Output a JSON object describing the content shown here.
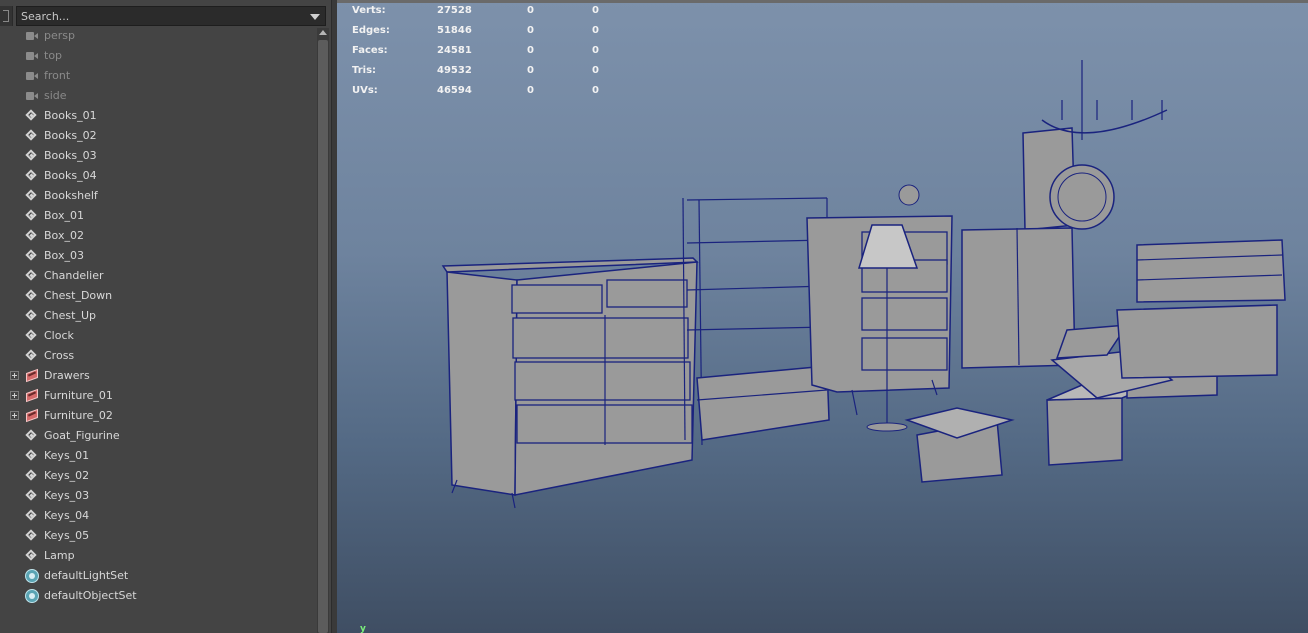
{
  "outliner": {
    "search_placeholder": "Search...",
    "items": [
      {
        "label": "persp",
        "type": "camera",
        "dim": true
      },
      {
        "label": "top",
        "type": "camera",
        "dim": true
      },
      {
        "label": "front",
        "type": "camera",
        "dim": true
      },
      {
        "label": "side",
        "type": "camera",
        "dim": true
      },
      {
        "label": "Books_01",
        "type": "mesh"
      },
      {
        "label": "Books_02",
        "type": "mesh"
      },
      {
        "label": "Books_03",
        "type": "mesh"
      },
      {
        "label": "Books_04",
        "type": "mesh"
      },
      {
        "label": "Bookshelf",
        "type": "mesh"
      },
      {
        "label": "Box_01",
        "type": "mesh"
      },
      {
        "label": "Box_02",
        "type": "mesh"
      },
      {
        "label": "Box_03",
        "type": "mesh"
      },
      {
        "label": "Chandelier",
        "type": "mesh"
      },
      {
        "label": "Chest_Down",
        "type": "mesh"
      },
      {
        "label": "Chest_Up",
        "type": "mesh"
      },
      {
        "label": "Clock",
        "type": "mesh"
      },
      {
        "label": "Cross",
        "type": "mesh"
      },
      {
        "label": "Drawers",
        "type": "group",
        "expandable": true
      },
      {
        "label": "Furniture_01",
        "type": "group",
        "expandable": true
      },
      {
        "label": "Furniture_02",
        "type": "group",
        "expandable": true
      },
      {
        "label": "Goat_Figurine",
        "type": "mesh"
      },
      {
        "label": "Keys_01",
        "type": "mesh"
      },
      {
        "label": "Keys_02",
        "type": "mesh"
      },
      {
        "label": "Keys_03",
        "type": "mesh"
      },
      {
        "label": "Keys_04",
        "type": "mesh"
      },
      {
        "label": "Keys_05",
        "type": "mesh"
      },
      {
        "label": "Lamp",
        "type": "mesh"
      },
      {
        "label": "defaultLightSet",
        "type": "set"
      },
      {
        "label": "defaultObjectSet",
        "type": "set"
      }
    ]
  },
  "viewport": {
    "hud": [
      {
        "label": "Verts:",
        "v1": "27528",
        "v2": "0",
        "v3": "0"
      },
      {
        "label": "Edges:",
        "v1": "51846",
        "v2": "0",
        "v3": "0"
      },
      {
        "label": "Faces:",
        "v1": "24581",
        "v2": "0",
        "v3": "0"
      },
      {
        "label": "Tris:",
        "v1": "49532",
        "v2": "0",
        "v3": "0"
      },
      {
        "label": "UVs:",
        "v1": "46594",
        "v2": "0",
        "v3": "0"
      }
    ],
    "axis_label": "y",
    "wire_color": "#1a237e",
    "mesh_color": "#9a9a9a"
  }
}
